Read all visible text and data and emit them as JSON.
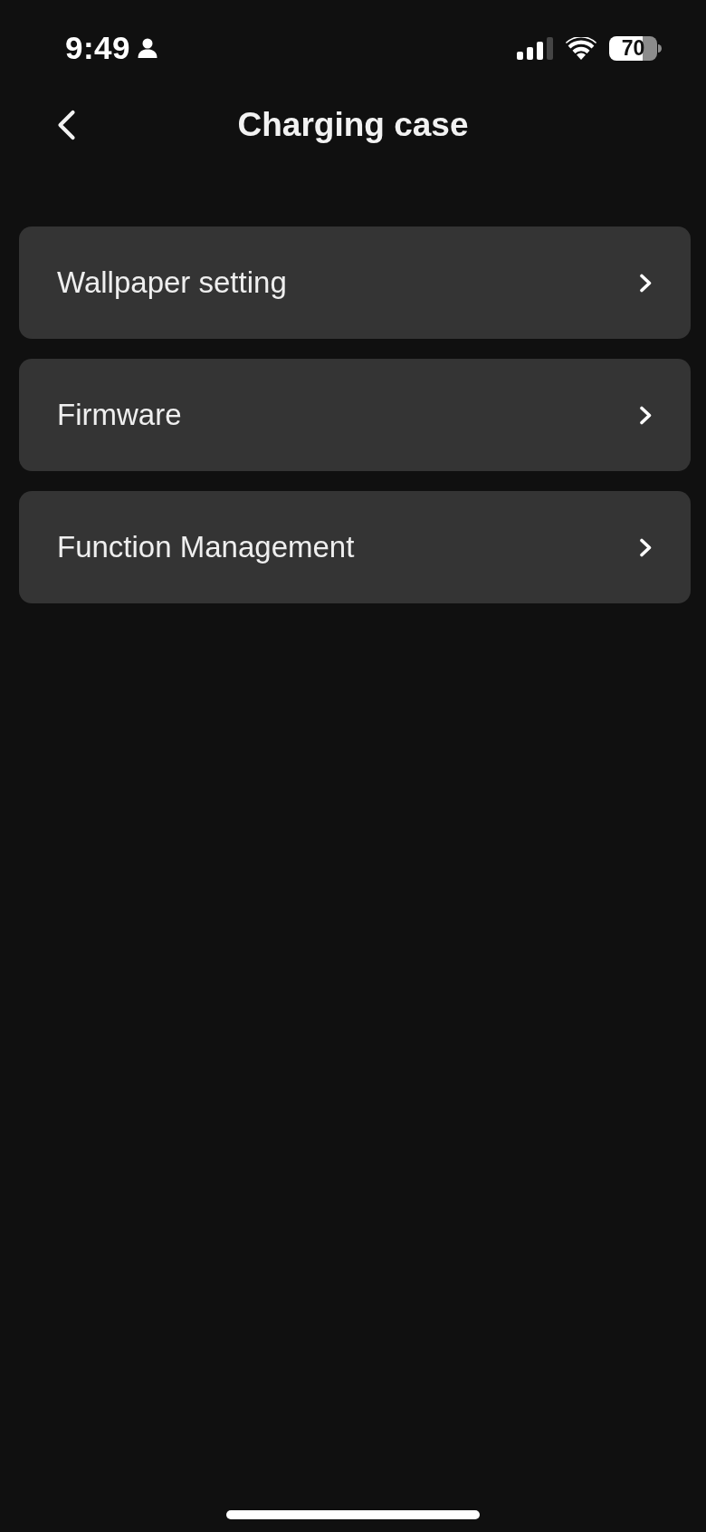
{
  "status_bar": {
    "time": "9:49",
    "battery": "70"
  },
  "header": {
    "title": "Charging case"
  },
  "menu": [
    {
      "label": "Wallpaper setting"
    },
    {
      "label": "Firmware"
    },
    {
      "label": "Function Management"
    }
  ]
}
